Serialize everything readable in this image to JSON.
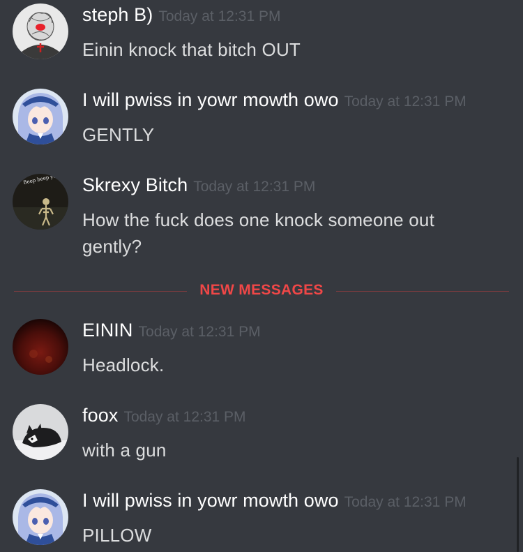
{
  "messages": [
    {
      "author": "steph B)",
      "timestamp": "Today at 12:31 PM",
      "text": "Einin knock that bitch OUT",
      "avatar": "scribble-face-avatar"
    },
    {
      "author": "I will pwiss in yowr mowth owo",
      "timestamp": "Today at 12:31 PM",
      "text": "GENTLY",
      "avatar": "anime-girl-avatar"
    },
    {
      "author": "Skrexy Bitch",
      "timestamp": "Today at 12:31 PM",
      "text": "How the fuck does one knock someone out gently?",
      "avatar": "skeleton-avatar",
      "avatar_caption": "Beep beep you sad fuck"
    },
    {
      "author": "EININ",
      "timestamp": "Today at 12:31 PM",
      "text": "Headlock.",
      "avatar": "dark-red-avatar"
    },
    {
      "author": "foox",
      "timestamp": "Today at 12:31 PM",
      "text": "with a gun",
      "avatar": "cat-avatar"
    },
    {
      "author": "I will pwiss in yowr mowth owo",
      "timestamp": "Today at 12:31 PM",
      "text": "PILLOW",
      "avatar": "anime-girl-avatar"
    }
  ],
  "divider": {
    "label": "NEW MESSAGES"
  },
  "colors": {
    "background": "#36393f",
    "author": "#ffffff",
    "timestamp": "#5b5f66",
    "content": "#dcddde",
    "new_messages": "#f04747"
  }
}
